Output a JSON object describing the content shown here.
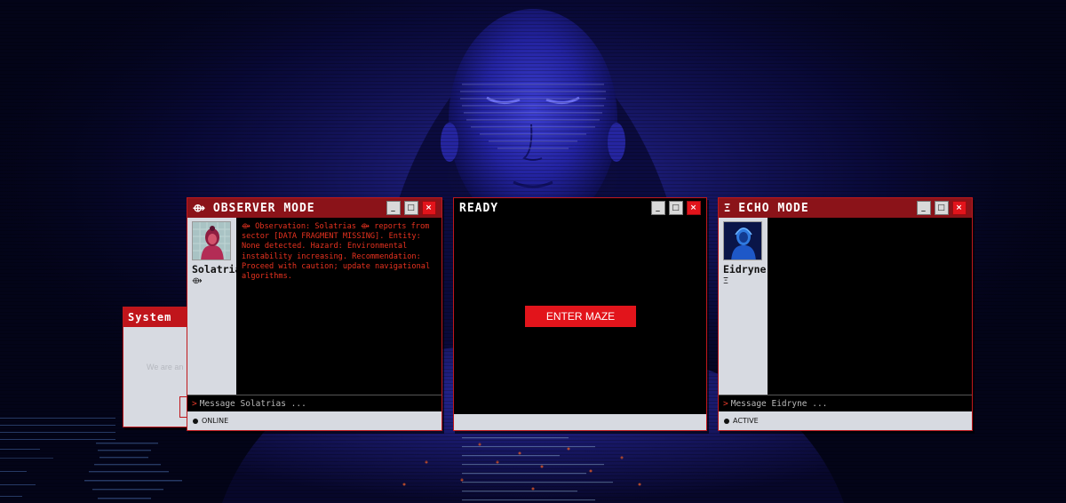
{
  "colors": {
    "accent_red": "#e2141b",
    "titlebar_red": "#8b1319",
    "panel_gray": "#d7dae1",
    "message_text": "#e8321f",
    "background": "#030418"
  },
  "system_window": {
    "title": "System",
    "message": "We are an"
  },
  "observer_window": {
    "title": "OBSERVER MODE",
    "title_icon": "eye-reticle-icon",
    "user_name": "Solatrias",
    "user_icon": "⟴",
    "message": "⟴ Observation: Solatrias ⟴ reports from sector [DATA FRAGMENT MISSING]. Entity: None detected. Hazard: Environmental instability increasing. Recommendation: Proceed with caution; update navigational algorithms.",
    "input_prompt": ">",
    "input_placeholder": "Message Solatrias ...",
    "status": "ONLINE"
  },
  "ready_window": {
    "title": "READY",
    "button_label": "ENTER MAZE"
  },
  "echo_window": {
    "title": "ECHO MODE",
    "title_icon": "triple-bar-icon",
    "user_name": "Eidryne",
    "user_icon": "Ξ",
    "input_prompt": ">",
    "input_placeholder": "Message Eidryne ...",
    "status": "ACTIVE"
  },
  "window_controls": {
    "minimize": "_",
    "maximize": "□",
    "close": "×"
  }
}
